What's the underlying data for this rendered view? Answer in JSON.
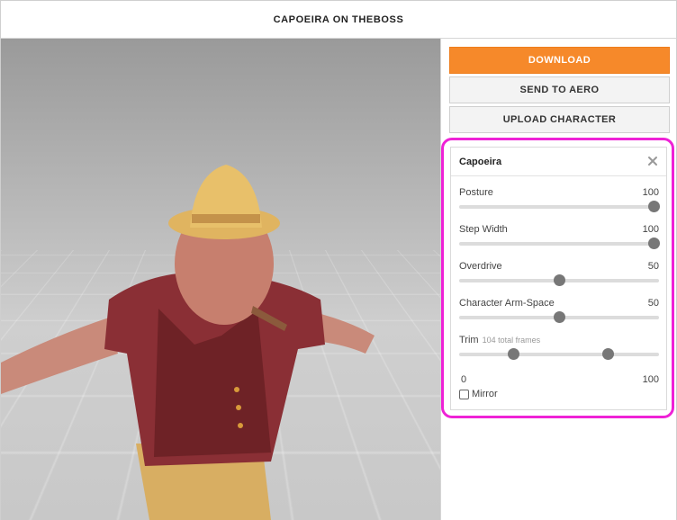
{
  "header": {
    "title": "CAPOEIRA ON THEBOSS"
  },
  "buttons": {
    "download": "DOWNLOAD",
    "send_to_aero": "SEND TO AERO",
    "upload_character": "UPLOAD CHARACTER"
  },
  "panel": {
    "title": "Capoeira",
    "close_icon": "close-icon",
    "sliders": [
      {
        "label": "Posture",
        "value": "100",
        "level": 1.0
      },
      {
        "label": "Step Width",
        "value": "100",
        "level": 1.0
      },
      {
        "label": "Overdrive",
        "value": "50",
        "level": 0.5
      },
      {
        "label": "Character Arm-Space",
        "value": "50",
        "level": 0.5
      }
    ],
    "trim": {
      "label": "Trim",
      "sublabel": "104 total frames",
      "min_label": "0",
      "max_label": "100",
      "start_level": 0.27,
      "end_level": 0.745
    },
    "mirror": {
      "label": "Mirror",
      "checked": false
    }
  },
  "colors": {
    "accent": "#f6892a",
    "highlight": "#ee22d6",
    "slider_thumb": "#777777"
  }
}
